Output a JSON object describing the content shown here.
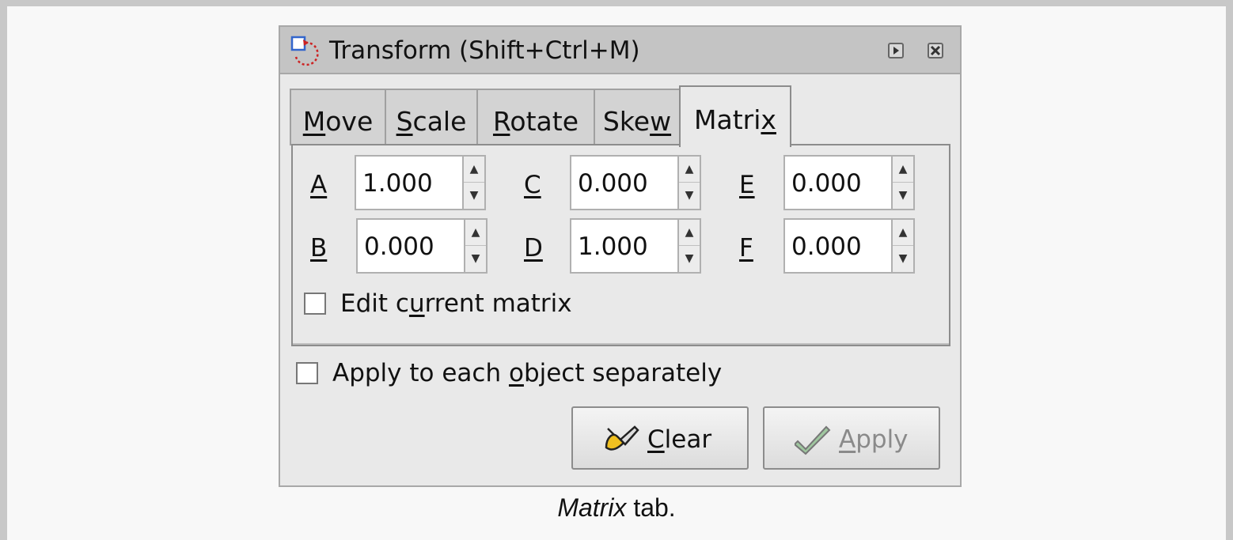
{
  "window": {
    "title": "Transform (Shift+Ctrl+M)"
  },
  "tabs": [
    {
      "label": "Move",
      "mnemonic": "M",
      "rest": "ove"
    },
    {
      "label": "Scale",
      "mnemonic": "S",
      "rest": "cale"
    },
    {
      "label": "Rotate",
      "mnemonic": "R",
      "rest": "otate"
    },
    {
      "label": "Skew",
      "pre": "Ske",
      "mnemonic": "w"
    },
    {
      "label": "Matrix",
      "pre": "Matri",
      "mnemonic": "x"
    }
  ],
  "active_tab": "Matrix",
  "matrix": {
    "A": {
      "label": "A",
      "value": "1.000"
    },
    "B": {
      "label": "B",
      "value": "0.000"
    },
    "C": {
      "label": "C",
      "value": "0.000"
    },
    "D": {
      "label": "D",
      "value": "1.000"
    },
    "E": {
      "label": "E",
      "value": "0.000"
    },
    "F": {
      "label": "F",
      "value": "0.000"
    }
  },
  "edit_current": {
    "pre": "Edit c",
    "mnemonic": "u",
    "post": "rrent matrix",
    "checked": false
  },
  "apply_each": {
    "pre": "Apply to each ",
    "mnemonic": "o",
    "post": "bject separately",
    "checked": false
  },
  "buttons": {
    "clear": {
      "mnemonic": "C",
      "rest": "lear",
      "icon": "brush-icon"
    },
    "apply": {
      "mnemonic": "A",
      "rest": "pply",
      "icon": "checkmark-icon",
      "disabled": true
    }
  },
  "caption": {
    "italic": "Matrix",
    "rest": " tab."
  },
  "colors": {
    "titlebar": "#c4c4c4",
    "dialog_bg": "#e9e9e9",
    "page_bg": "#f8f8f8"
  }
}
